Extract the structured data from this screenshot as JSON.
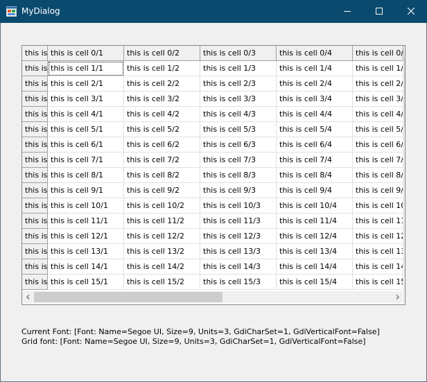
{
  "window": {
    "title": "MyDialog",
    "icon": "app-window-icon",
    "controls": [
      "minimize-icon",
      "maximize-icon",
      "close-icon"
    ]
  },
  "grid": {
    "header_row": [
      "this is",
      "this is cell 0/1",
      "this is cell 0/2",
      "this is cell 0/3",
      "this is cell 0/4",
      "this is cell 0/"
    ],
    "rows": [
      [
        "this is",
        "this is cell 1/1",
        "this is cell 1/2",
        "this is cell 1/3",
        "this is cell 1/4",
        "this is cell 1/"
      ],
      [
        "this is",
        "this is cell 2/1",
        "this is cell 2/2",
        "this is cell 2/3",
        "this is cell 2/4",
        "this is cell 2/"
      ],
      [
        "this is",
        "this is cell 3/1",
        "this is cell 3/2",
        "this is cell 3/3",
        "this is cell 3/4",
        "this is cell 3/"
      ],
      [
        "this is",
        "this is cell 4/1",
        "this is cell 4/2",
        "this is cell 4/3",
        "this is cell 4/4",
        "this is cell 4/"
      ],
      [
        "this is",
        "this is cell 5/1",
        "this is cell 5/2",
        "this is cell 5/3",
        "this is cell 5/4",
        "this is cell 5/"
      ],
      [
        "this is",
        "this is cell 6/1",
        "this is cell 6/2",
        "this is cell 6/3",
        "this is cell 6/4",
        "this is cell 6/"
      ],
      [
        "this is",
        "this is cell 7/1",
        "this is cell 7/2",
        "this is cell 7/3",
        "this is cell 7/4",
        "this is cell 7/"
      ],
      [
        "this is",
        "this is cell 8/1",
        "this is cell 8/2",
        "this is cell 8/3",
        "this is cell 8/4",
        "this is cell 8/"
      ],
      [
        "this is",
        "this is cell 9/1",
        "this is cell 9/2",
        "this is cell 9/3",
        "this is cell 9/4",
        "this is cell 9/"
      ],
      [
        "this is",
        "this is cell 10/1",
        "this is cell 10/2",
        "this is cell 10/3",
        "this is cell 10/4",
        "this is cell 10"
      ],
      [
        "this is",
        "this is cell 11/1",
        "this is cell 11/2",
        "this is cell 11/3",
        "this is cell 11/4",
        "this is cell 11"
      ],
      [
        "this is",
        "this is cell 12/1",
        "this is cell 12/2",
        "this is cell 12/3",
        "this is cell 12/4",
        "this is cell 12"
      ],
      [
        "this is",
        "this is cell 13/1",
        "this is cell 13/2",
        "this is cell 13/3",
        "this is cell 13/4",
        "this is cell 13"
      ],
      [
        "this is",
        "this is cell 14/1",
        "this is cell 14/2",
        "this is cell 14/3",
        "this is cell 14/4",
        "this is cell 14"
      ],
      [
        "this is",
        "this is cell 15/1",
        "this is cell 15/2",
        "this is cell 15/3",
        "this is cell 15/4",
        "this is cell 15"
      ]
    ],
    "focused_cell": "this is cell 1/1",
    "scrollbars": {
      "vertical_icons": [
        "scroll-up-icon",
        "scroll-down-icon"
      ],
      "horizontal_icons": [
        "scroll-left-icon",
        "scroll-right-icon"
      ]
    }
  },
  "info": {
    "current_font": "Current Font: [Font: Name=Segoe UI, Size=9, Units=3, GdiCharSet=1, GdiVerticalFont=False]",
    "grid_font": "Grid font: [Font: Name=Segoe UI, Size=9, Units=3, GdiCharSet=1, GdiVerticalFont=False]"
  },
  "colors": {
    "titlebar": "#0a4a6e",
    "dialog_background": "#f0f0f0",
    "fixed_cell_background": "#f0f0f0",
    "cell_background": "#ffffff"
  }
}
